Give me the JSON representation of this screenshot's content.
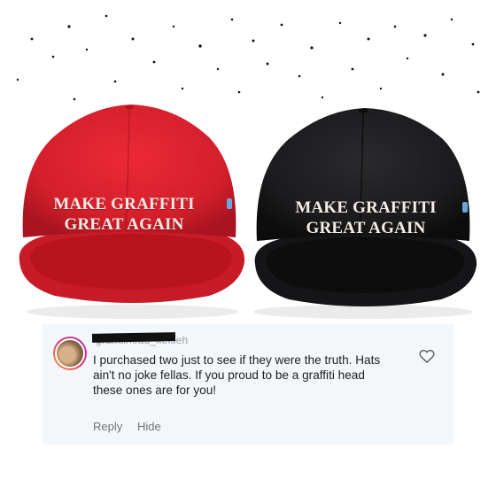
{
  "hats": {
    "red": {
      "line1": "MAKE GRAFFITI",
      "line2": "GREAT AGAIN",
      "color": "#d8202e"
    },
    "black": {
      "line1": "MAKE GRAFFITI",
      "line2": "GREAT AGAIN",
      "color": "#1b1b1d"
    }
  },
  "comment": {
    "username": "graffitihead_kelseh",
    "text": "I purchased two just to see if they were the truth. Hats ain't no joke fellas. If you proud to be a graffiti head these ones are for you!",
    "reply_label": "Reply",
    "hide_label": "Hide",
    "icons": {
      "like": "heart-outline-icon"
    }
  }
}
